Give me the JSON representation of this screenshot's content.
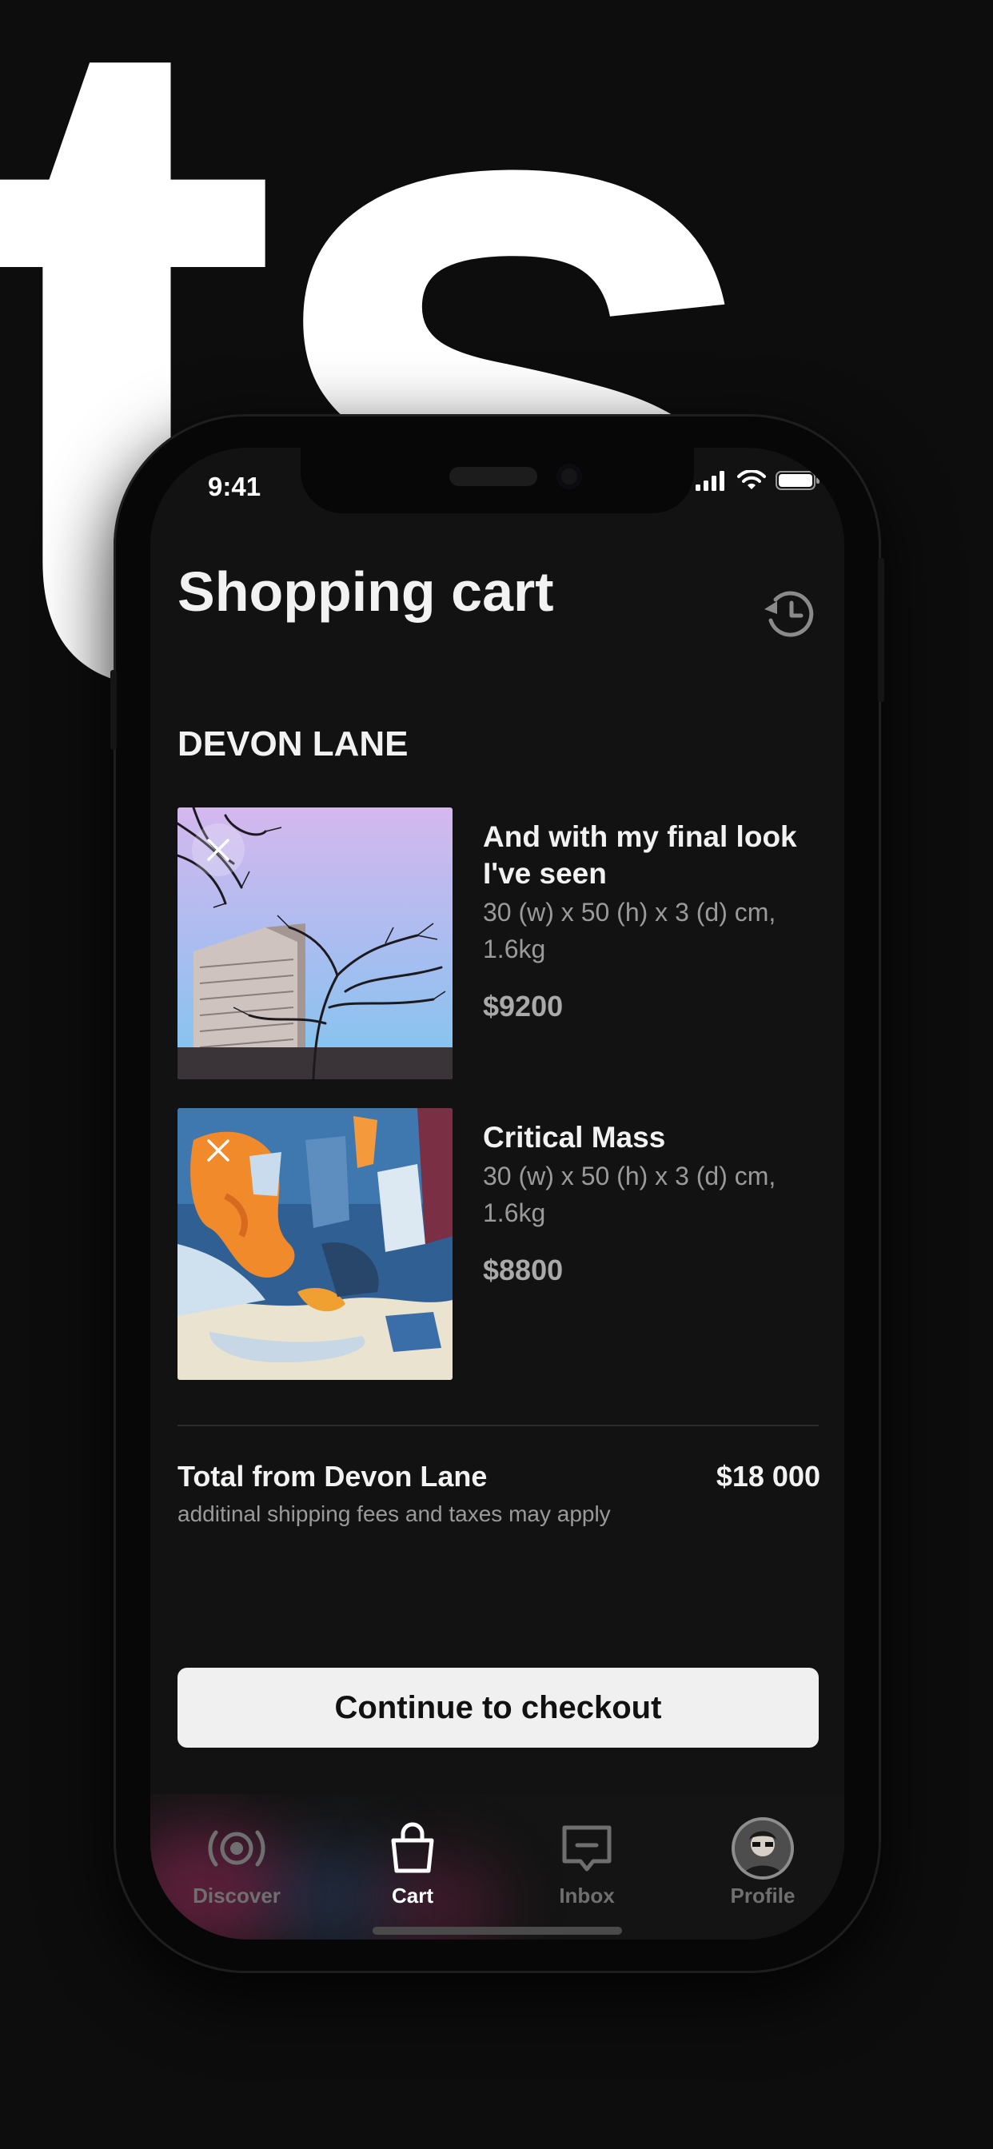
{
  "background": {
    "word": "ts"
  },
  "status_bar": {
    "time": "9:41"
  },
  "header": {
    "title": "Shopping cart",
    "history_icon": "history-icon"
  },
  "store": {
    "name": "DEVON LANE"
  },
  "items": [
    {
      "title": "And with my final look I've seen",
      "dimensions": "30 (w) x 50 (h) x 3 (d) cm, 1.6kg",
      "price": "$9200",
      "image": "building with bare tree against purple-blue sky"
    },
    {
      "title": "Critical Mass",
      "dimensions": "30 (w) x 50 (h) x 3 (d) cm, 1.6kg",
      "price": "$8800",
      "image": "abstract blue and orange paint strokes"
    }
  ],
  "summary": {
    "label": "Total from Devon Lane",
    "value": "$18 000",
    "note": "additinal shipping fees and taxes may apply"
  },
  "checkout": {
    "label": "Continue to checkout"
  },
  "tabbar": {
    "active": "Cart",
    "tabs": [
      {
        "label": "Discover",
        "icon": "broadcast-icon"
      },
      {
        "label": "Cart",
        "icon": "shopping-bag-icon"
      },
      {
        "label": "Inbox",
        "icon": "message-icon"
      },
      {
        "label": "Profile",
        "icon": "avatar"
      }
    ]
  },
  "colors": {
    "background": "#0d0d0d",
    "screen": "#121212",
    "text_primary": "#f2f2f2",
    "text_secondary": "#9a9a9a",
    "button": "#f0f0f0",
    "tab_inactive": "#6f6f6f"
  }
}
